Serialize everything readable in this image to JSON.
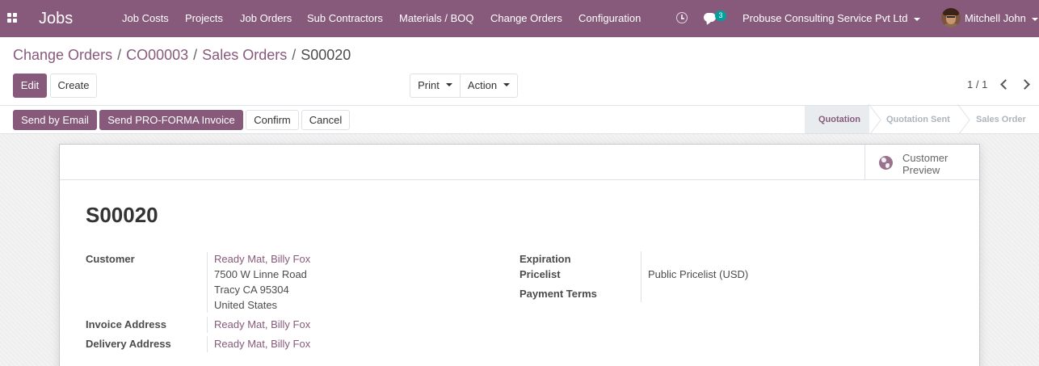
{
  "navbar": {
    "brand": "Jobs",
    "menu": [
      "Job Costs",
      "Projects",
      "Job Orders",
      "Sub Contractors",
      "Materials / BOQ",
      "Change Orders",
      "Configuration"
    ],
    "chat_count": "3",
    "company": "Probuse Consulting Service Pvt Ltd",
    "user": "Mitchell John"
  },
  "breadcrumb": {
    "items": [
      "Change Orders",
      "CO00003",
      "Sales Orders"
    ],
    "separator": "/",
    "current": "S00020"
  },
  "toolbar": {
    "edit_label": "Edit",
    "create_label": "Create",
    "print_label": "Print",
    "action_label": "Action",
    "pager": "1 / 1"
  },
  "actions": {
    "send_email": "Send by Email",
    "send_proforma": "Send PRO-FORMA Invoice",
    "confirm": "Confirm",
    "cancel": "Cancel"
  },
  "statusbar": {
    "stages": [
      "Quotation",
      "Quotation Sent",
      "Sales Order"
    ],
    "active": "Quotation"
  },
  "smart_button": {
    "label_line1": "Customer",
    "label_line2": "Preview"
  },
  "record": {
    "title": "S00020",
    "customer_label": "Customer",
    "customer_name": "Ready Mat, Billy Fox",
    "address_lines": [
      "7500 W Linne Road",
      "Tracy CA 95304",
      "United States"
    ],
    "invoice_address_label": "Invoice Address",
    "invoice_address": "Ready Mat, Billy Fox",
    "delivery_address_label": "Delivery Address",
    "delivery_address": "Ready Mat, Billy Fox",
    "expiration_label": "Expiration",
    "expiration": "",
    "pricelist_label": "Pricelist",
    "pricelist": "Public Pricelist (USD)",
    "payment_terms_label": "Payment Terms",
    "payment_terms": ""
  },
  "colors": {
    "brand": "#875a7b",
    "badge": "#00a09d",
    "active_stage_bg": "#e9ecef"
  },
  "icons": [
    "apps-grid-icon",
    "clock-icon",
    "chat-icon",
    "caret-down-icon",
    "chevron-left-icon",
    "chevron-right-icon",
    "globe-icon"
  ]
}
